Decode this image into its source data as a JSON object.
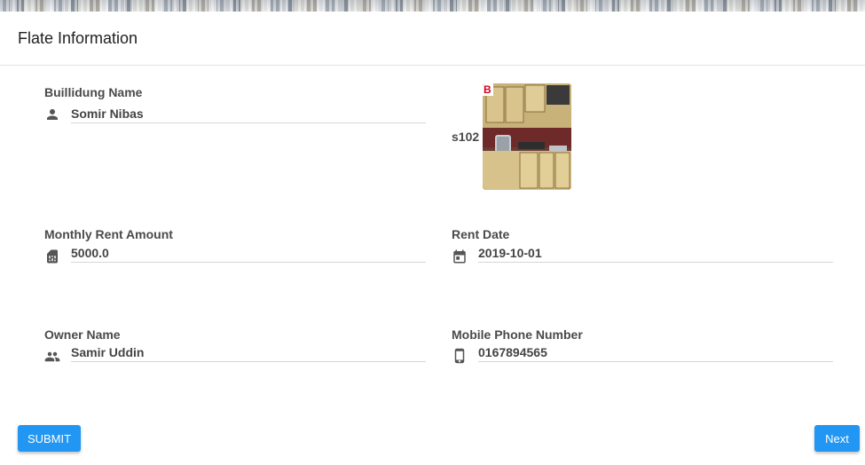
{
  "header": {
    "title": "Flate Information"
  },
  "fields": {
    "building_name": {
      "label": "Buillidung Name",
      "value": "Somir Nibas",
      "icon": "person-icon"
    },
    "monthly_rent": {
      "label": "Monthly Rent Amount",
      "value": "5000.0",
      "icon": "sim-card-icon"
    },
    "rent_date": {
      "label": "Rent Date",
      "value": "2019-10-01",
      "icon": "calendar-icon"
    },
    "owner_name": {
      "label": "Owner Name",
      "value": "Samir Uddin",
      "icon": "people-icon"
    },
    "mobile": {
      "label": "Mobile Phone Number",
      "value": "0167894565",
      "icon": "smartphone-icon"
    }
  },
  "flat_photo": {
    "label": "s102",
    "badge": "B"
  },
  "buttons": {
    "submit": "SUBMIT",
    "next": "Next"
  },
  "colors": {
    "primary": "#2196f3",
    "text": "#4a4a4a"
  }
}
